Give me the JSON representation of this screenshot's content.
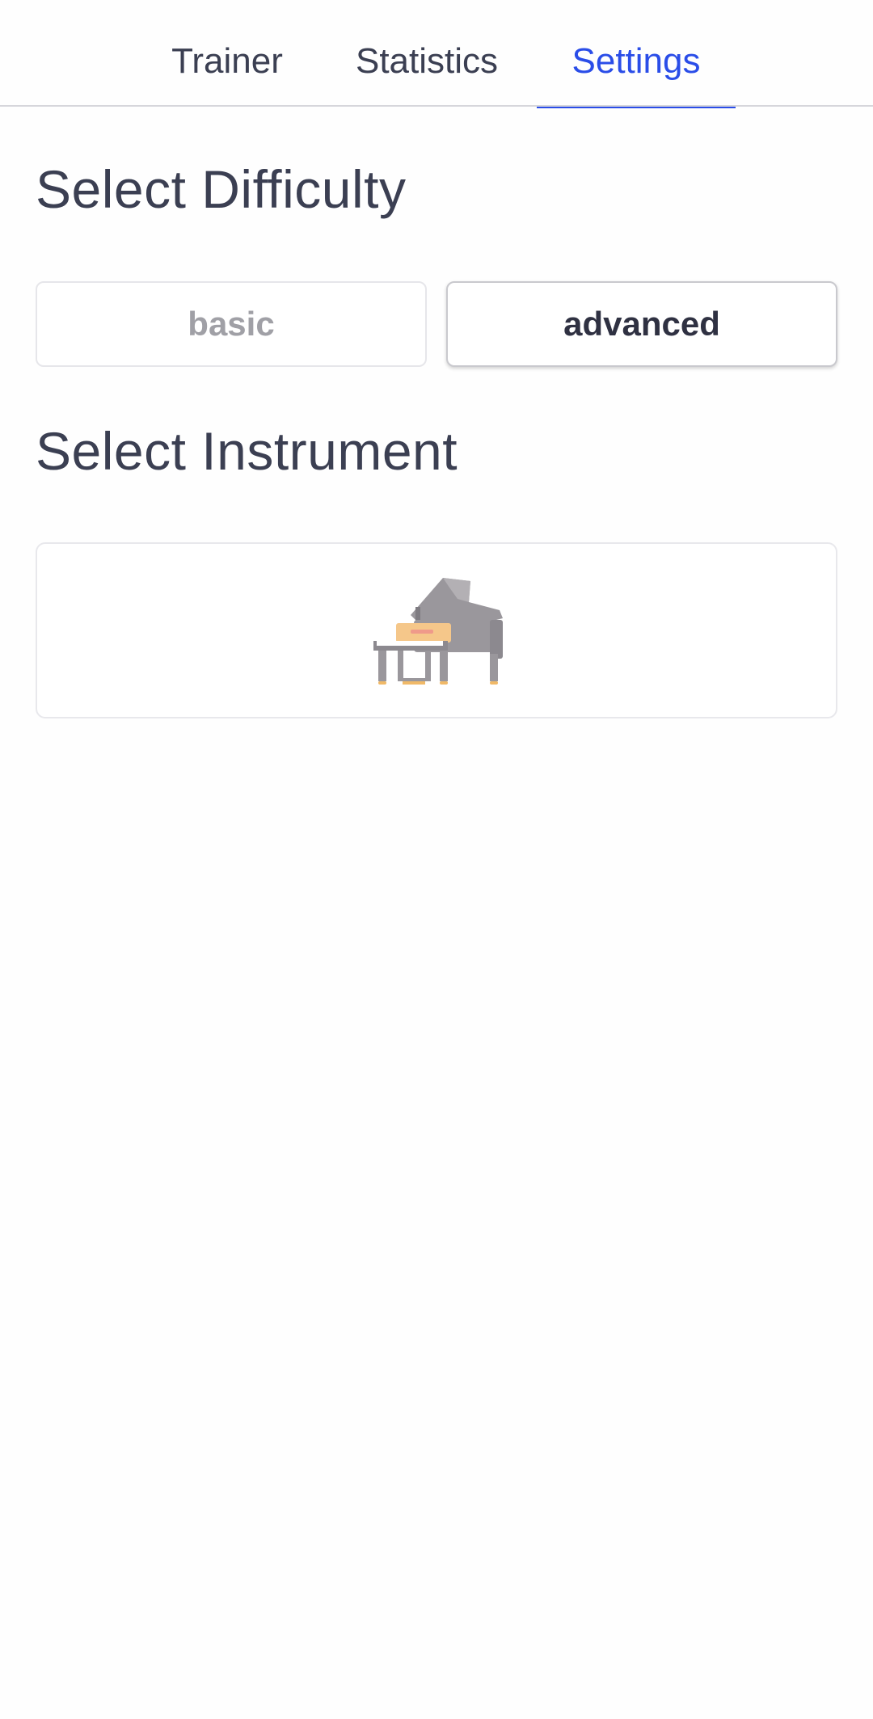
{
  "tabs": {
    "trainer": "Trainer",
    "statistics": "Statistics",
    "settings": "Settings",
    "active": "settings"
  },
  "difficulty": {
    "heading": "Select Difficulty",
    "options": [
      "basic",
      "advanced"
    ],
    "selected": "advanced"
  },
  "instrument": {
    "heading": "Select Instrument",
    "icon": "grand-piano-icon"
  },
  "colors": {
    "accent": "#2a4de8",
    "text": "#3b3f52",
    "muted": "#a0a0a6"
  }
}
